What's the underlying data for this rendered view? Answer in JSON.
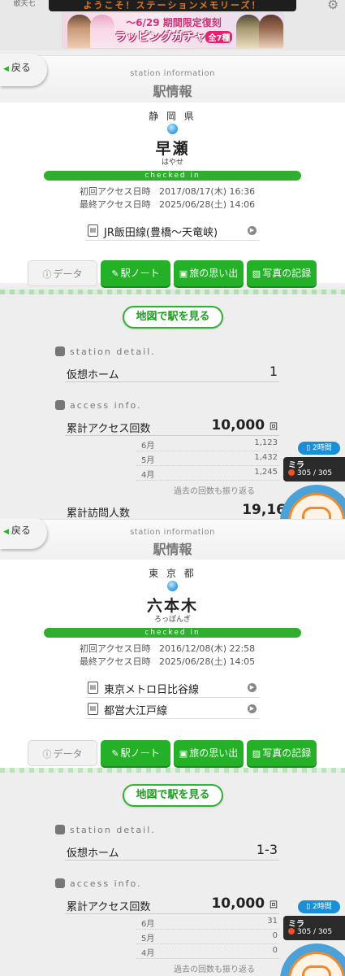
{
  "header": {
    "side_label": "歌天七",
    "ticker_text": "ようこそ！ステーションメモリーズ！",
    "banner": {
      "line1": "～6/29 期間限定復刻",
      "line2": "ラッピングガチャ",
      "tag": "全7種"
    }
  },
  "screens": [
    {
      "back_label": "戻る",
      "title_en": "station information",
      "title_jp": "駅情報",
      "prefecture": "静 岡 県",
      "station_name": "早瀬",
      "station_kana": "はやせ",
      "status": "checked in",
      "first_access_label": "初回アクセス日時",
      "first_access_value": "2017/08/17(木) 16:36",
      "last_access_label": "最終アクセス日時",
      "last_access_value": "2025/06/28(土) 14:06",
      "lines": [
        "JR飯田線(豊橋～天竜峡)"
      ],
      "tabs": {
        "data": "データ",
        "note": "駅ノート",
        "memories": "旅の思い出",
        "photos": "写真の記録"
      },
      "map_button": "地図で駅を見る",
      "detail_heading": "station detail.",
      "platform_label": "仮想ホーム",
      "platform_value": "1",
      "access_heading": "access info.",
      "total_access_label": "累計アクセス回数",
      "total_access_value": "10,000",
      "count_unit": "回",
      "monthly": [
        {
          "month": "6月",
          "count": "1,123"
        },
        {
          "month": "5月",
          "count": "1,432"
        },
        {
          "month": "4月",
          "count": "1,245"
        }
      ],
      "more_link": "過去の回数も振り返る",
      "visitors_label": "累計訪問人数",
      "visitors_value": "19,16"
    },
    {
      "back_label": "戻る",
      "title_en": "station information",
      "title_jp": "駅情報",
      "prefecture": "東 京 都",
      "station_name": "六本木",
      "station_kana": "ろっぽんぎ",
      "status": "checked in",
      "first_access_label": "初回アクセス日時",
      "first_access_value": "2016/12/08(木) 22:58",
      "last_access_label": "最終アクセス日時",
      "last_access_value": "2025/06/28(土) 14:05",
      "lines": [
        "東京メトロ日比谷線",
        "都営大江戸線"
      ],
      "tabs": {
        "data": "データ",
        "note": "駅ノート",
        "memories": "旅の思い出",
        "photos": "写真の記録"
      },
      "map_button": "地図で駅を見る",
      "detail_heading": "station detail.",
      "platform_label": "仮想ホーム",
      "platform_value": "1-3",
      "access_heading": "access info.",
      "total_access_label": "累計アクセス回数",
      "total_access_value": "10,000",
      "count_unit": "回",
      "monthly": [
        {
          "month": "6月",
          "count": "31"
        },
        {
          "month": "5月",
          "count": "0"
        },
        {
          "month": "4月",
          "count": "0"
        }
      ],
      "more_link": "過去の回数も振り返る"
    }
  ],
  "mira": {
    "time": "2時間",
    "name": "ミラ",
    "hp": "305 / 305"
  }
}
